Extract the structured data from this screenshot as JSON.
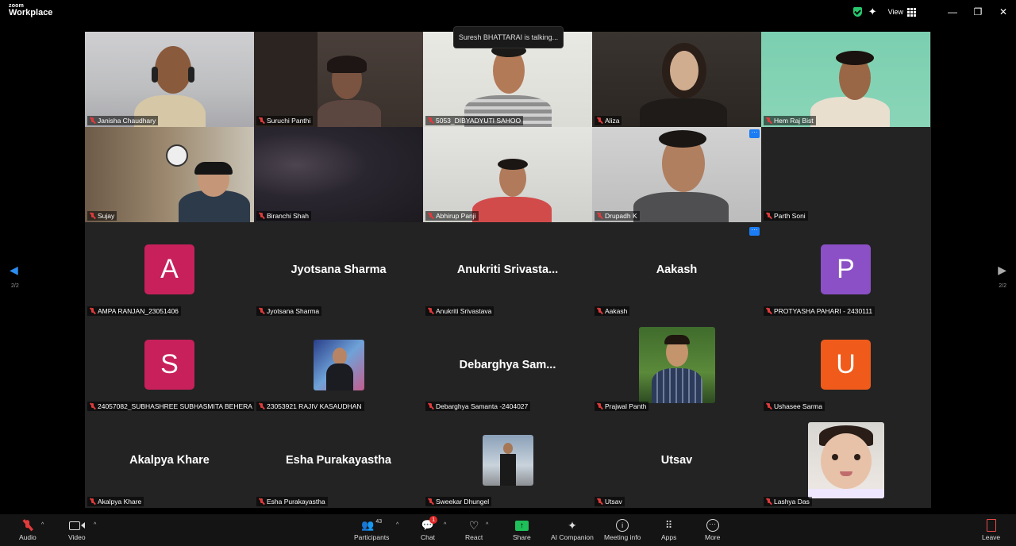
{
  "app": {
    "logo_small": "zoom",
    "logo_big": "Workplace"
  },
  "topbar": {
    "view_label": "View",
    "minimize": "—",
    "restore": "❐",
    "close": "✕"
  },
  "talking_indicator": "Suresh BHATTARAI is talking...",
  "video_tiles": [
    {
      "name": "Janisha Chaudhary"
    },
    {
      "name": "Suruchi Panthi"
    },
    {
      "name": "5053_DIBYADYUTI SAHOO"
    },
    {
      "name": "Aliza"
    },
    {
      "name": "Hem Raj Bist"
    },
    {
      "name": "Sujay"
    },
    {
      "name": "Biranchi Shah"
    },
    {
      "name": "Abhirup Panji"
    },
    {
      "name": "Drupadh K"
    },
    {
      "name": "Parth Soni"
    }
  ],
  "audio_tiles": [
    {
      "label": "AMPA RANJAN_23051406",
      "avatar_letter": "A",
      "avatar_color": "#c7205a"
    },
    {
      "label": "Jyotsana Sharma",
      "display": "Jyotsana Sharma"
    },
    {
      "label": "Anukriti Srivastava",
      "display": "Anukriti  Srivasta..."
    },
    {
      "label": "Aakash",
      "display": "Aakash"
    },
    {
      "label": "PROTYASHA PAHARI - 2430111",
      "avatar_letter": "P",
      "avatar_color": "#8b4fc6"
    },
    {
      "label": "24057082_SUBHASHREE SUBHASMITA BEHERA",
      "avatar_letter": "S",
      "avatar_color": "#c7205a"
    },
    {
      "label": "23053921 RAJIV KASAUDHAN"
    },
    {
      "label": "Debarghya Samanta -2404027",
      "display": "Debarghya  Sam..."
    },
    {
      "label": "Prajwal Panth"
    },
    {
      "label": "Ushasee Sarma",
      "avatar_letter": "U",
      "avatar_color": "#f05a1a"
    },
    {
      "label": "Akalpya Khare",
      "display": "Akalpya Khare"
    },
    {
      "label": "Esha Purakayastha",
      "display": "Esha Purakayastha"
    },
    {
      "label": "Sweekar Dhungel"
    },
    {
      "label": "Utsav",
      "display": "Utsav"
    },
    {
      "label": "Lashya Das"
    }
  ],
  "page_indicator_left": "2/2",
  "page_indicator_right": "2/2",
  "toolbar": {
    "audio": "Audio",
    "video": "Video",
    "participants": "Participants",
    "participants_count": "43",
    "chat": "Chat",
    "chat_badge": "1",
    "react": "React",
    "share": "Share",
    "ai_companion": "AI Companion",
    "meeting_info": "Meeting info",
    "apps": "Apps",
    "more": "More",
    "leave": "Leave"
  }
}
